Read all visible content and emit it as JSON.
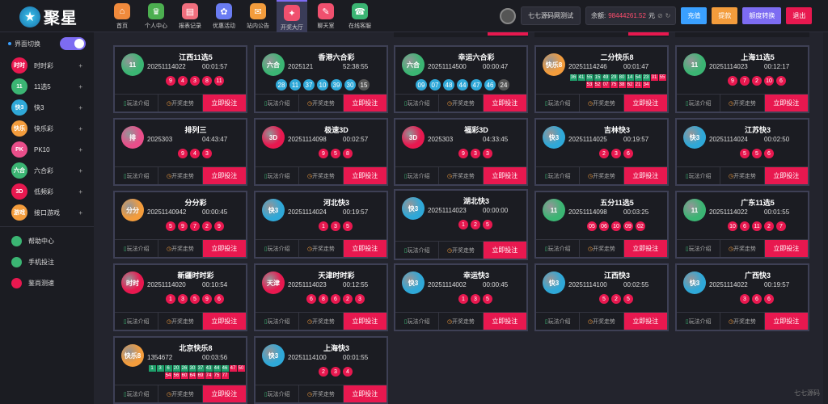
{
  "app": {
    "logo_text": "聚星"
  },
  "nav": [
    {
      "label": "首页",
      "icon": "home-icon",
      "color": "#f08a3c"
    },
    {
      "label": "个人中心",
      "icon": "crown-icon",
      "color": "#4caf50"
    },
    {
      "label": "报表记录",
      "icon": "report-icon",
      "color": "#f06f7e"
    },
    {
      "label": "优惠活动",
      "icon": "gift-icon",
      "color": "#6a7cf2"
    },
    {
      "label": "站内公告",
      "icon": "mail-icon",
      "color": "#f39c3c"
    },
    {
      "label": "开奖大厅",
      "icon": "lottery-icon",
      "color": "#f0506e"
    },
    {
      "label": "聊天室",
      "icon": "chat-icon",
      "color": "#f0506e"
    },
    {
      "label": "在线客服",
      "icon": "service-icon",
      "color": "#3bb573"
    }
  ],
  "user": {
    "name": "七七源码网测试",
    "balance_label": "余额:",
    "balance_value": "98444261.52",
    "balance_unit": "元"
  },
  "buttons": {
    "recharge": "充值",
    "withdraw": "提款",
    "transfer": "额度转换",
    "logout": "退出"
  },
  "sidebar": {
    "toggle_label": "界面切换",
    "items": [
      {
        "label": "时时彩",
        "icon": "ssc-icon",
        "badge": "时时",
        "color": "#e8184f"
      },
      {
        "label": "11选5",
        "icon": "11x5-icon",
        "badge": "11",
        "color": "#3bb573"
      },
      {
        "label": "快3",
        "icon": "k3-icon",
        "badge": "快3",
        "color": "#2fa8d8"
      },
      {
        "label": "快乐彩",
        "icon": "kuaile-icon",
        "badge": "快乐",
        "color": "#f39c3c"
      },
      {
        "label": "PK10",
        "icon": "pk10-icon",
        "badge": "PK",
        "color": "#e94e8a"
      },
      {
        "label": "六合彩",
        "icon": "lhc-icon",
        "badge": "六合",
        "color": "#3bb573"
      },
      {
        "label": "低频彩",
        "icon": "dipin-icon",
        "badge": "3D",
        "color": "#e8184f"
      },
      {
        "label": "接口游戏",
        "icon": "api-game-icon",
        "badge": "游戏",
        "color": "#f39c3c"
      }
    ],
    "links": [
      {
        "label": "帮助中心",
        "icon": "help-icon",
        "color": "#3bb573"
      },
      {
        "label": "手机投注",
        "icon": "mobile-bet-icon",
        "color": "#3bb573"
      },
      {
        "label": "鉴尚测速",
        "icon": "speed-test-icon",
        "color": "#e8184f"
      }
    ]
  },
  "card_labels": {
    "rules": "玩法介绍",
    "trend": "开奖走势",
    "bet": "立即投注"
  },
  "cards": [
    {
      "name": "江西11选5",
      "issue": "20251114022",
      "time": "00:01:57",
      "logo": "11",
      "logo_color": "#3bb573",
      "balls": [
        "9",
        "4",
        "3",
        "8",
        "11"
      ],
      "style": "red"
    },
    {
      "name": "香港六合彩",
      "issue": "2025121",
      "time": "52:38:55",
      "logo": "六合",
      "logo_color": "#3bb573",
      "balls": [
        "28",
        "11",
        "37",
        "10",
        "39",
        "30",
        "15"
      ],
      "style": "blue"
    },
    {
      "name": "幸运六合彩",
      "issue": "20251114500",
      "time": "00:00:47",
      "logo": "六合",
      "logo_color": "#3bb573",
      "balls": [
        "09",
        "07",
        "48",
        "44",
        "47",
        "46",
        "24"
      ],
      "style": "blue"
    },
    {
      "name": "二分快乐8",
      "issue": "20251114246",
      "time": "00:01:47",
      "logo": "快乐8",
      "logo_color": "#f39c3c",
      "balls": [
        "36",
        "41",
        "55",
        "15",
        "49",
        "29",
        "80",
        "14",
        "54",
        "23",
        "31",
        "55",
        "53",
        "52",
        "07",
        "75",
        "38",
        "62",
        "21",
        "34"
      ],
      "style": "sq"
    },
    {
      "name": "上海11选5",
      "issue": "20251114023",
      "time": "00:12:17",
      "logo": "11",
      "logo_color": "#3bb573",
      "balls": [
        "9",
        "7",
        "2",
        "10",
        "6"
      ],
      "style": "red"
    },
    {
      "name": "排列三",
      "issue": "2025303",
      "time": "04:43:47",
      "logo": "排",
      "logo_color": "#e94e8a",
      "balls": [
        "9",
        "4",
        "3"
      ],
      "style": "red"
    },
    {
      "name": "极速3D",
      "issue": "20251114098",
      "time": "00:02:57",
      "logo": "3D",
      "logo_color": "#e8184f",
      "balls": [
        "9",
        "5",
        "8"
      ],
      "style": "red"
    },
    {
      "name": "福彩3D",
      "issue": "2025303",
      "time": "04:33:45",
      "logo": "3D",
      "logo_color": "#e8184f",
      "balls": [
        "9",
        "3",
        "3"
      ],
      "style": "red"
    },
    {
      "name": "吉林快3",
      "issue": "20251114025",
      "time": "00:19:57",
      "logo": "快3",
      "logo_color": "#2fa8d8",
      "balls": [
        "2",
        "3",
        "6"
      ],
      "style": "red"
    },
    {
      "name": "江苏快3",
      "issue": "20251114024",
      "time": "00:02:50",
      "logo": "快3",
      "logo_color": "#2fa8d8",
      "balls": [
        "5",
        "5",
        "6"
      ],
      "style": "red"
    },
    {
      "name": "分分彩",
      "issue": "20251140942",
      "time": "00:00:45",
      "logo": "分分",
      "logo_color": "#f39c3c",
      "balls": [
        "5",
        "9",
        "7",
        "2",
        "9"
      ],
      "style": "red"
    },
    {
      "name": "河北快3",
      "issue": "20251114024",
      "time": "00:19:57",
      "logo": "快3",
      "logo_color": "#2fa8d8",
      "balls": [
        "1",
        "3",
        "5"
      ],
      "style": "red"
    },
    {
      "name": "湖北快3",
      "issue": "20251114023",
      "time": "00:00:00",
      "logo": "快3",
      "logo_color": "#2fa8d8",
      "balls": [
        "1",
        "2",
        "5"
      ],
      "style": "red"
    },
    {
      "name": "五分11选5",
      "issue": "20251114098",
      "time": "00:03:25",
      "logo": "11",
      "logo_color": "#3bb573",
      "balls": [
        "05",
        "06",
        "10",
        "09",
        "02"
      ],
      "style": "red"
    },
    {
      "name": "广东11选5",
      "issue": "20251114022",
      "time": "00:01:55",
      "logo": "11",
      "logo_color": "#3bb573",
      "balls": [
        "10",
        "6",
        "11",
        "2",
        "7"
      ],
      "style": "red"
    },
    {
      "name": "新疆时时彩",
      "issue": "20251114020",
      "time": "00:10:54",
      "logo": "时时",
      "logo_color": "#e8184f",
      "balls": [
        "1",
        "3",
        "5",
        "9",
        "6"
      ],
      "style": "red"
    },
    {
      "name": "天津时时彩",
      "issue": "20251114023",
      "time": "00:12:55",
      "logo": "天津",
      "logo_color": "#e8184f",
      "balls": [
        "6",
        "8",
        "6",
        "2",
        "3"
      ],
      "style": "red"
    },
    {
      "name": "幸运快3",
      "issue": "20251114002",
      "time": "00:00:45",
      "logo": "快3",
      "logo_color": "#2fa8d8",
      "balls": [
        "1",
        "3",
        "5"
      ],
      "style": "red"
    },
    {
      "name": "江西快3",
      "issue": "20251114100",
      "time": "00:02:55",
      "logo": "快3",
      "logo_color": "#2fa8d8",
      "balls": [
        "5",
        "2",
        "5"
      ],
      "style": "red"
    },
    {
      "name": "广西快3",
      "issue": "20251114022",
      "time": "00:19:57",
      "logo": "快3",
      "logo_color": "#2fa8d8",
      "balls": [
        "3",
        "6",
        "6"
      ],
      "style": "red"
    },
    {
      "name": "北京快乐8",
      "issue": "1354672",
      "time": "00:03:56",
      "logo": "快乐8",
      "logo_color": "#f39c3c",
      "balls": [
        "1",
        "3",
        "6",
        "20",
        "26",
        "30",
        "37",
        "43",
        "44",
        "46",
        "47",
        "50",
        "54",
        "56",
        "60",
        "64",
        "69",
        "74",
        "75",
        "77"
      ],
      "style": "sq"
    },
    {
      "name": "上海快3",
      "issue": "20251114100",
      "time": "00:01:55",
      "logo": "快3",
      "logo_color": "#2fa8d8",
      "balls": [
        "2",
        "3",
        "4"
      ],
      "style": "red"
    }
  ]
}
